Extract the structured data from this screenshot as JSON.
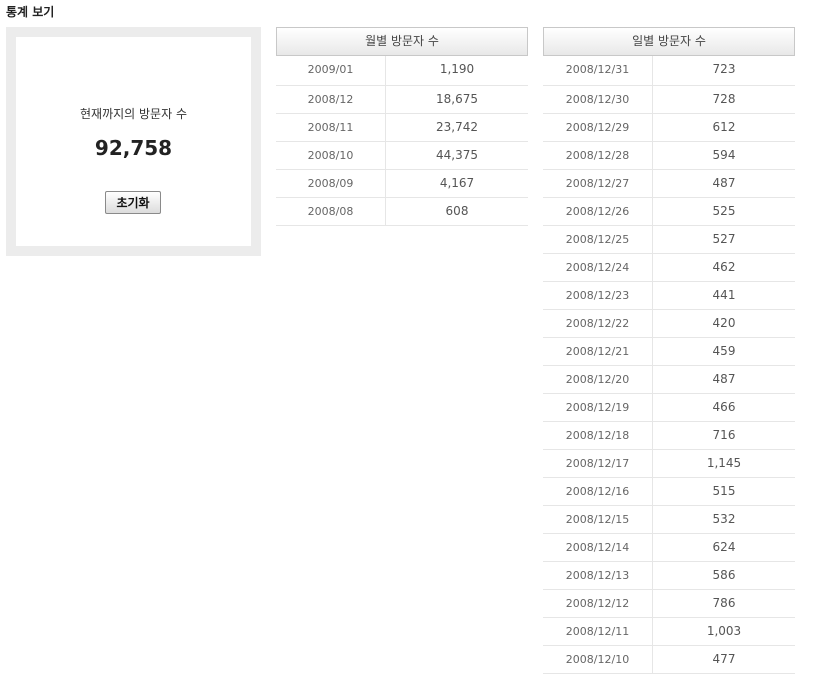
{
  "page": {
    "title": "통계 보기"
  },
  "total": {
    "label": "현재까지의 방문자 수",
    "value": "92,758",
    "reset_label": "초기화"
  },
  "monthly": {
    "header": "월별 방문자 수",
    "rows": [
      {
        "date": "2009/01",
        "count": "1,190"
      },
      {
        "date": "2008/12",
        "count": "18,675"
      },
      {
        "date": "2008/11",
        "count": "23,742"
      },
      {
        "date": "2008/10",
        "count": "44,375"
      },
      {
        "date": "2008/09",
        "count": "4,167"
      },
      {
        "date": "2008/08",
        "count": "608"
      }
    ]
  },
  "daily": {
    "header": "일별 방문자 수",
    "rows": [
      {
        "date": "2008/12/31",
        "count": "723"
      },
      {
        "date": "2008/12/30",
        "count": "728"
      },
      {
        "date": "2008/12/29",
        "count": "612"
      },
      {
        "date": "2008/12/28",
        "count": "594"
      },
      {
        "date": "2008/12/27",
        "count": "487"
      },
      {
        "date": "2008/12/26",
        "count": "525"
      },
      {
        "date": "2008/12/25",
        "count": "527"
      },
      {
        "date": "2008/12/24",
        "count": "462"
      },
      {
        "date": "2008/12/23",
        "count": "441"
      },
      {
        "date": "2008/12/22",
        "count": "420"
      },
      {
        "date": "2008/12/21",
        "count": "459"
      },
      {
        "date": "2008/12/20",
        "count": "487"
      },
      {
        "date": "2008/12/19",
        "count": "466"
      },
      {
        "date": "2008/12/18",
        "count": "716"
      },
      {
        "date": "2008/12/17",
        "count": "1,145"
      },
      {
        "date": "2008/12/16",
        "count": "515"
      },
      {
        "date": "2008/12/15",
        "count": "532"
      },
      {
        "date": "2008/12/14",
        "count": "624"
      },
      {
        "date": "2008/12/13",
        "count": "586"
      },
      {
        "date": "2008/12/12",
        "count": "786"
      },
      {
        "date": "2008/12/11",
        "count": "1,003"
      },
      {
        "date": "2008/12/10",
        "count": "477"
      }
    ]
  }
}
